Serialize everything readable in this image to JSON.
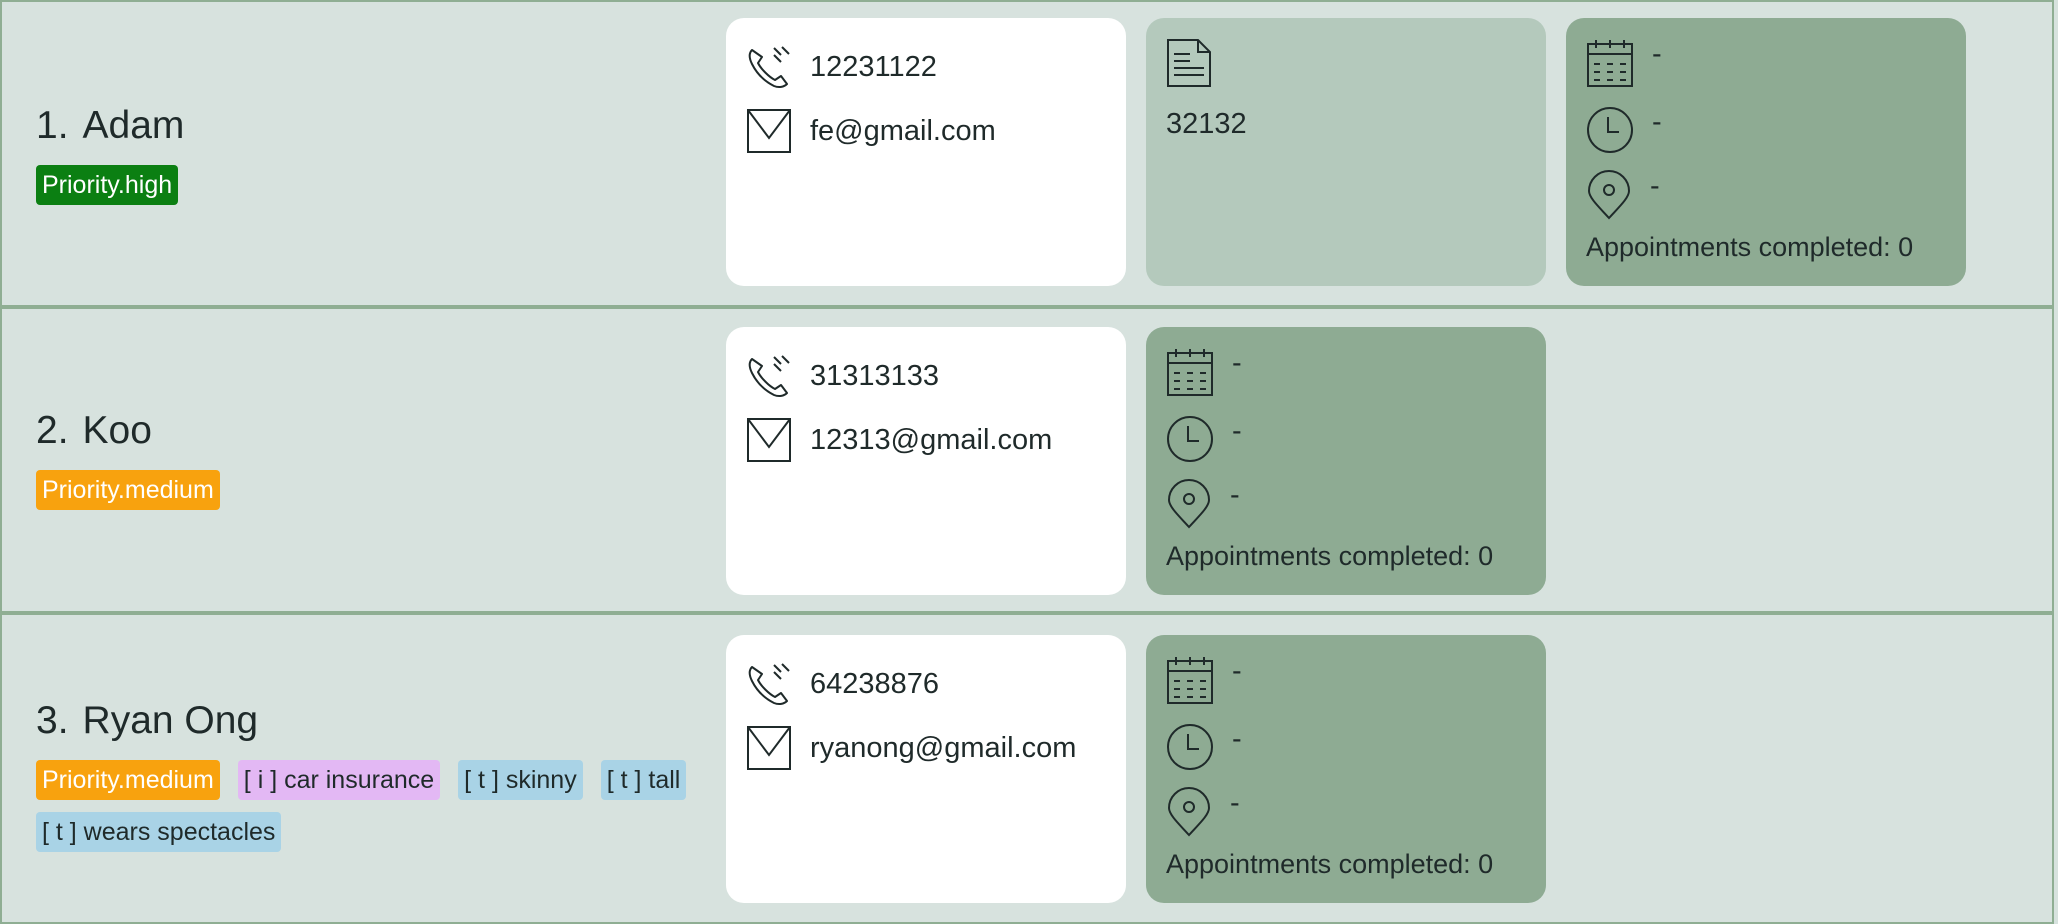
{
  "persons": [
    {
      "index": "1.",
      "name": "Adam",
      "priority": "Priority.high",
      "phone": "12231122",
      "email": "fe@gmail.com",
      "policy": "32132",
      "appointment": {
        "date": "-",
        "time": "-",
        "location": "-",
        "completed": "Appointments completed: 0"
      }
    },
    {
      "index": "2.",
      "name": "Koo",
      "priority": "Priority.medium",
      "phone": "31313133",
      "email": "12313@gmail.com",
      "appointment": {
        "date": "-",
        "time": "-",
        "location": "-",
        "completed": "Appointments completed: 0"
      }
    },
    {
      "index": "3.",
      "name": "Ryan Ong",
      "priority": "Priority.medium",
      "tags": [
        "[ i ] car insurance",
        "[ t ] skinny",
        "[ t ] tall",
        "[ t ] wears spectacles"
      ],
      "phone": "64238876",
      "email": "ryanong@gmail.com",
      "appointment": {
        "date": "-",
        "time": "-",
        "location": "-",
        "completed": "Appointments completed: 0"
      }
    }
  ],
  "icons": {
    "phone": "phone-icon",
    "email": "envelope-icon",
    "policy": "document-icon",
    "date": "calendar-icon",
    "time": "clock-icon",
    "location": "location-pin-icon"
  },
  "colors": {
    "priority_high": "#0b7f12",
    "priority_medium": "#f8a20e",
    "insurance_tag": "#e3b8f4",
    "trait_tag": "#a9d3e6",
    "contact_card": "#ffffff",
    "policy_card": "#b4c9bc",
    "appointment_card": "#8eab93",
    "background": "#d7e2de"
  }
}
